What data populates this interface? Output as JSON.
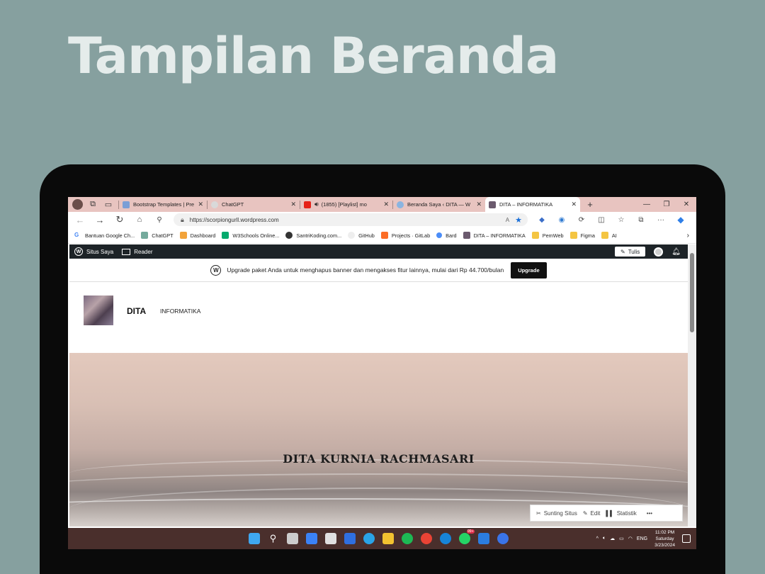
{
  "slide": {
    "title": "Tampilan Beranda"
  },
  "browser": {
    "tabs": [
      {
        "title": "Bootstrap Templates | Pre",
        "active": false
      },
      {
        "title": "ChatGPT",
        "active": false
      },
      {
        "title": "(1855) [Playlist] mo",
        "active": false
      },
      {
        "title": "Beranda Saya ‹ DITA — W",
        "active": false
      },
      {
        "title": "DITA – INFORMATIKA",
        "active": true
      }
    ],
    "url": "https://scorpiongurll.wordpress.com",
    "bookmarks": [
      "Bantuan Google Ch...",
      "ChatGPT",
      "Dashboard",
      "W3Schools Online...",
      "SantriKoding.com...",
      "GitHub",
      "Projects · GitLab",
      "Bard",
      "DITA – INFORMATIKA",
      "PemWeb",
      "Figma",
      "AI"
    ]
  },
  "wp_admin": {
    "my_site": "Situs Saya",
    "reader": "Reader",
    "write": "Tulis"
  },
  "banner": {
    "text": "Upgrade paket Anda untuk menghapus banner dan mengakses fitur lainnya, mulai dari Rp 44.700/bulan",
    "button": "Upgrade"
  },
  "site": {
    "name": "DITA",
    "tagline": "INFORMATIKA",
    "hero_title": "DITA KURNIA RACHMASARI"
  },
  "edit_bar": {
    "customize": "Sunting Situs",
    "edit": "Edit",
    "stats": "Statistik",
    "more": "•••"
  },
  "taskbar": {
    "lang": "ENG",
    "time": "11:02 PM",
    "day": "Saturday",
    "date": "3/23/2024",
    "whatsapp_badge": "99+"
  }
}
